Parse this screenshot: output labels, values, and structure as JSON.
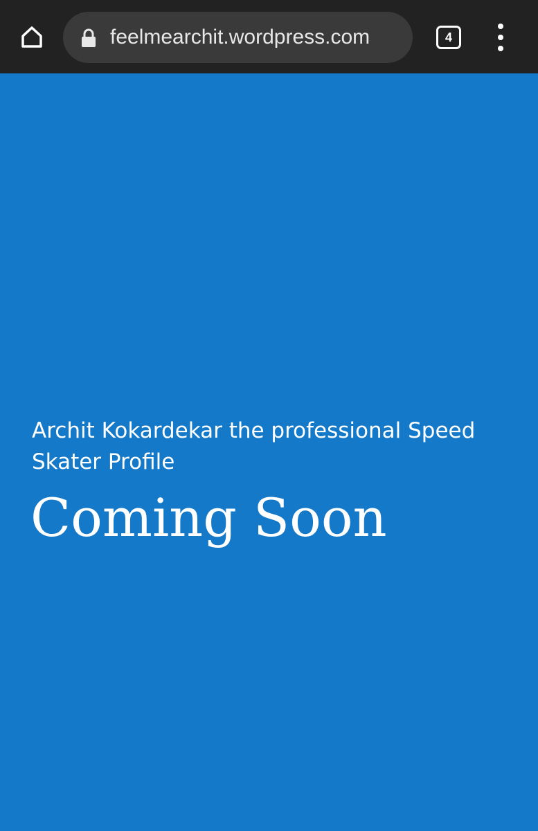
{
  "browser": {
    "url": "feelmearchit.wordpress.com",
    "tab_count": "4",
    "icons": {
      "home": "home-icon",
      "lock": "lock-icon",
      "menu": "more-vert-icon"
    }
  },
  "page": {
    "tagline": "Archit Kokardekar the professional Speed Skater Profile",
    "heading": "Coming Soon",
    "background_color": "#1479c9"
  }
}
